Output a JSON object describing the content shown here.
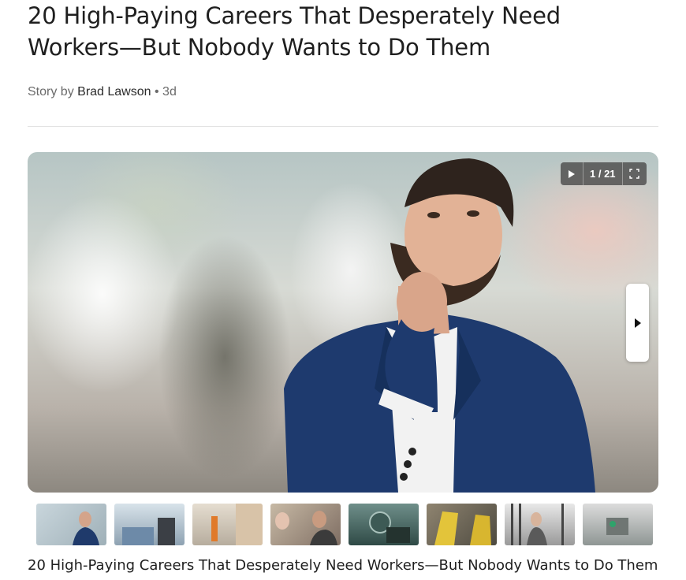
{
  "article": {
    "title": "20 High-Paying Careers That Desperately Need Workers—But Nobody Wants to Do Them",
    "byline_prefix": "Story by",
    "author": "Brad Lawson",
    "separator": "•",
    "age": "3d"
  },
  "slideshow": {
    "counter": "1 / 21",
    "play_icon": "play-icon",
    "fullscreen_icon": "fullscreen-icon",
    "next_icon": "chevron-right-icon",
    "caption": "20 High-Paying Careers That Desperately Need Workers—But Nobody Wants to Do Them",
    "thumbnails": [
      {
        "name": "thumb-1",
        "accent": "#1f3a6b"
      },
      {
        "name": "thumb-2",
        "accent": "#6d8aa8"
      },
      {
        "name": "thumb-3",
        "accent": "#e07a2a"
      },
      {
        "name": "thumb-4",
        "accent": "#8a6a5a"
      },
      {
        "name": "thumb-5",
        "accent": "#3d5a55"
      },
      {
        "name": "thumb-6",
        "accent": "#e3c43a"
      },
      {
        "name": "thumb-7",
        "accent": "#5a5a5a"
      },
      {
        "name": "thumb-8",
        "accent": "#2fa36b"
      }
    ]
  }
}
